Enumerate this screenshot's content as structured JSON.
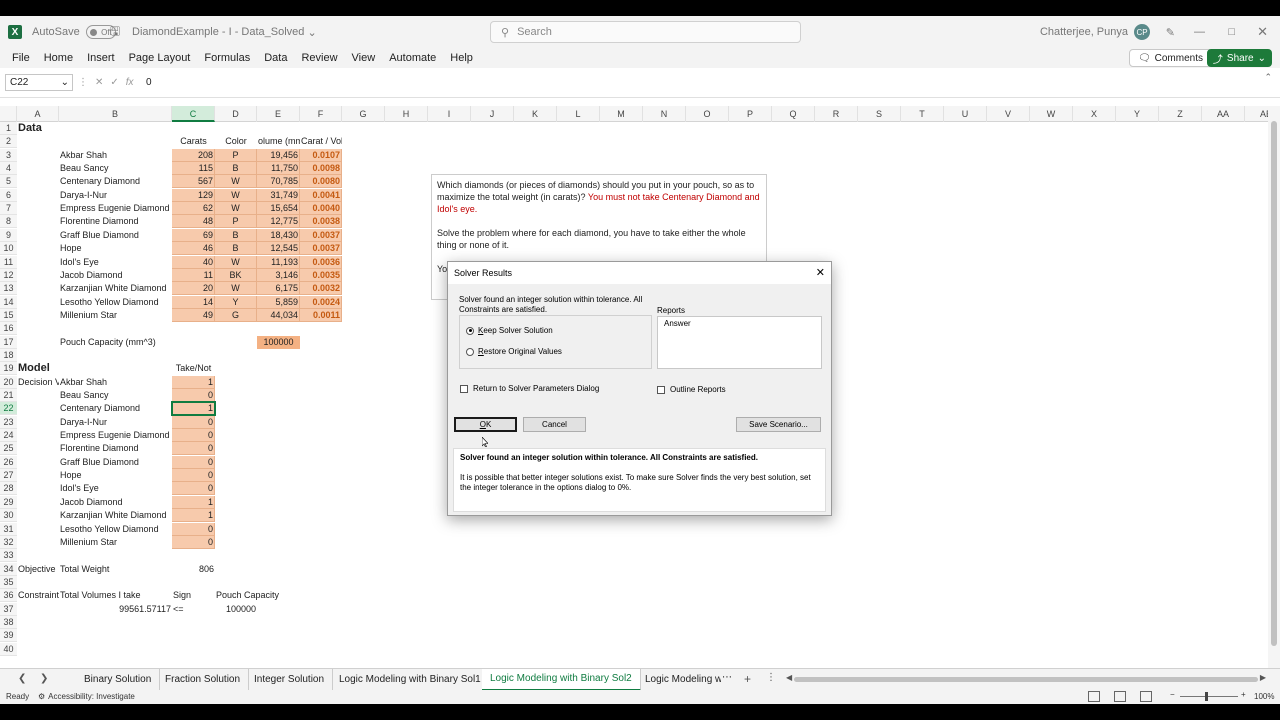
{
  "titlebar": {
    "autosave_label": "AutoSave",
    "autosave_state": "Off",
    "doc_title": "DiamondExample - I - Data_Solved",
    "search_placeholder": "Search",
    "user_name": "Chatterjee, Punya",
    "user_initials": "CP"
  },
  "ribbon": {
    "tabs": [
      "File",
      "Home",
      "Insert",
      "Page Layout",
      "Formulas",
      "Data",
      "Review",
      "View",
      "Automate",
      "Help"
    ],
    "comments_label": "Comments",
    "share_label": "Share"
  },
  "formula_bar": {
    "name_box": "C22",
    "content": "0"
  },
  "columns": [
    "A",
    "B",
    "C",
    "D",
    "E",
    "F",
    "G",
    "H",
    "I",
    "J",
    "K",
    "L",
    "M",
    "N",
    "O",
    "P",
    "Q",
    "R",
    "S",
    "T",
    "U",
    "V",
    "W",
    "X",
    "Y",
    "Z",
    "AA",
    "AB"
  ],
  "selected_column": "C",
  "selected_row": 22,
  "rows": [
    1,
    2,
    3,
    4,
    5,
    6,
    7,
    8,
    9,
    10,
    11,
    12,
    13,
    14,
    15,
    16,
    17,
    18,
    19,
    20,
    21,
    22,
    23,
    24,
    25,
    26,
    27,
    28,
    29,
    30,
    31,
    32,
    33,
    34,
    35,
    36,
    37,
    38,
    39,
    40
  ],
  "data_section": {
    "title": "Data",
    "headers": {
      "carats": "Carats",
      "color": "Color",
      "volume": "olume (mm",
      "ratio": "Carat / Vol"
    },
    "diamonds": [
      {
        "name": "Akbar Shah",
        "carats": "208",
        "color": "P",
        "volume": "19,456",
        "ratio": "0.0107"
      },
      {
        "name": "Beau Sancy",
        "carats": "115",
        "color": "B",
        "volume": "11,750",
        "ratio": "0.0098"
      },
      {
        "name": "Centenary Diamond",
        "carats": "567",
        "color": "W",
        "volume": "70,785",
        "ratio": "0.0080"
      },
      {
        "name": "Darya-I-Nur",
        "carats": "129",
        "color": "W",
        "volume": "31,749",
        "ratio": "0.0041"
      },
      {
        "name": "Empress Eugenie Diamond",
        "carats": "62",
        "color": "W",
        "volume": "15,654",
        "ratio": "0.0040"
      },
      {
        "name": "Florentine Diamond",
        "carats": "48",
        "color": "P",
        "volume": "12,775",
        "ratio": "0.0038"
      },
      {
        "name": "Graff Blue Diamond",
        "carats": "69",
        "color": "B",
        "volume": "18,430",
        "ratio": "0.0037"
      },
      {
        "name": "Hope",
        "carats": "46",
        "color": "B",
        "volume": "12,545",
        "ratio": "0.0037"
      },
      {
        "name": "Idol's Eye",
        "carats": "40",
        "color": "W",
        "volume": "11,193",
        "ratio": "0.0036"
      },
      {
        "name": "Jacob Diamond",
        "carats": "11",
        "color": "BK",
        "volume": "3,146",
        "ratio": "0.0035"
      },
      {
        "name": "Karzanjian White Diamond",
        "carats": "20",
        "color": "W",
        "volume": "6,175",
        "ratio": "0.0032"
      },
      {
        "name": "Lesotho Yellow Diamond",
        "carats": "14",
        "color": "Y",
        "volume": "5,859",
        "ratio": "0.0024"
      },
      {
        "name": "Millenium Star",
        "carats": "49",
        "color": "G",
        "volume": "44,034",
        "ratio": "0.0011"
      }
    ],
    "pouch_label": "Pouch Capacity (mm^3)",
    "pouch_value": "100000"
  },
  "model_section": {
    "title": "Model",
    "take_header": "Take/Not",
    "decision_label": "Decision V",
    "takes": [
      "1",
      "0",
      "1",
      "0",
      "0",
      "0",
      "0",
      "0",
      "0",
      "1",
      "1",
      "0",
      "0"
    ],
    "objective_label": "Objective",
    "total_weight_label": "Total Weight",
    "total_weight": "806",
    "constraint_label": "Constraint",
    "volumes_label": "Total Volumes I take",
    "sign_label": "Sign",
    "capacity_label": "Pouch Capacity",
    "volumes_value": "99561.57117",
    "sign_value": "<=",
    "capacity_value": "100000"
  },
  "textbox": {
    "para1_a": "Which diamonds (or pieces of diamonds) should you put in your pouch, so as to maximize the total weight (in carats)? ",
    "para1_red": "You must not take Centenary Diamond and Idol's eye.",
    "para2": "Solve the problem where for each diamond, you have to take either the whole thing or none of it.",
    "para3": "Yo"
  },
  "dialog": {
    "title": "Solver Results",
    "message": "Solver found an integer solution within tolerance.  All Constraints are satisfied.",
    "keep_label": "Keep Solver Solution",
    "restore_label": "Restore Original Values",
    "reports_label": "Reports",
    "reports_items": [
      "Answer"
    ],
    "return_label": "Return to Solver Parameters Dialog",
    "outline_label": "Outline Reports",
    "ok_label": "OK",
    "cancel_label": "Cancel",
    "save_label": "Save Scenario...",
    "info_bold": "Solver found an integer solution within tolerance.  All Constraints are satisfied.",
    "info_text": "It is possible that better integer solutions exist. To make sure Solver finds the very best solution, set the integer tolerance in the options dialog to 0%."
  },
  "sheet_tabs": [
    "Binary Solution",
    "Fraction Solution",
    "Integer Solution",
    "Logic Modeling with Binary Sol1",
    "Logic Modeling with Binary Sol2",
    "Logic Modeling w"
  ],
  "active_sheet": "Logic Modeling with Binary Sol2",
  "statusbar": {
    "ready": "Ready",
    "accessibility": "Accessibility: Investigate",
    "zoom": "100%"
  },
  "colors": {
    "excel_green": "#107c41",
    "input_fill": "#f7caac",
    "ratio_text": "#c55a11",
    "warning_text": "#c00000"
  }
}
